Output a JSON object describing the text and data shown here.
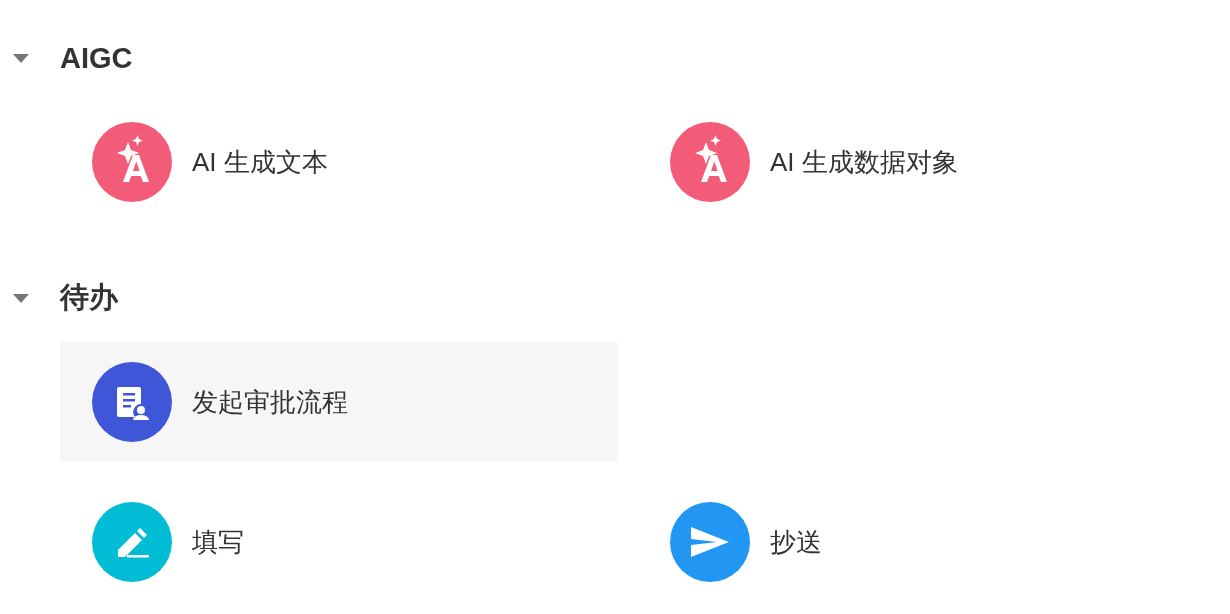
{
  "sections": [
    {
      "title": "AIGC",
      "expanded": true,
      "rows": [
        [
          {
            "label": "AI 生成文本",
            "kind": "ai",
            "selected": false
          },
          {
            "label": "AI 生成数据对象",
            "kind": "ai",
            "selected": false
          }
        ]
      ]
    },
    {
      "title": "待办",
      "expanded": true,
      "rows": [
        [
          {
            "label": "发起审批流程",
            "kind": "approval",
            "selected": true
          }
        ],
        [
          {
            "label": "填写",
            "kind": "fill",
            "selected": false
          },
          {
            "label": "抄送",
            "kind": "send",
            "selected": false
          }
        ]
      ]
    }
  ]
}
